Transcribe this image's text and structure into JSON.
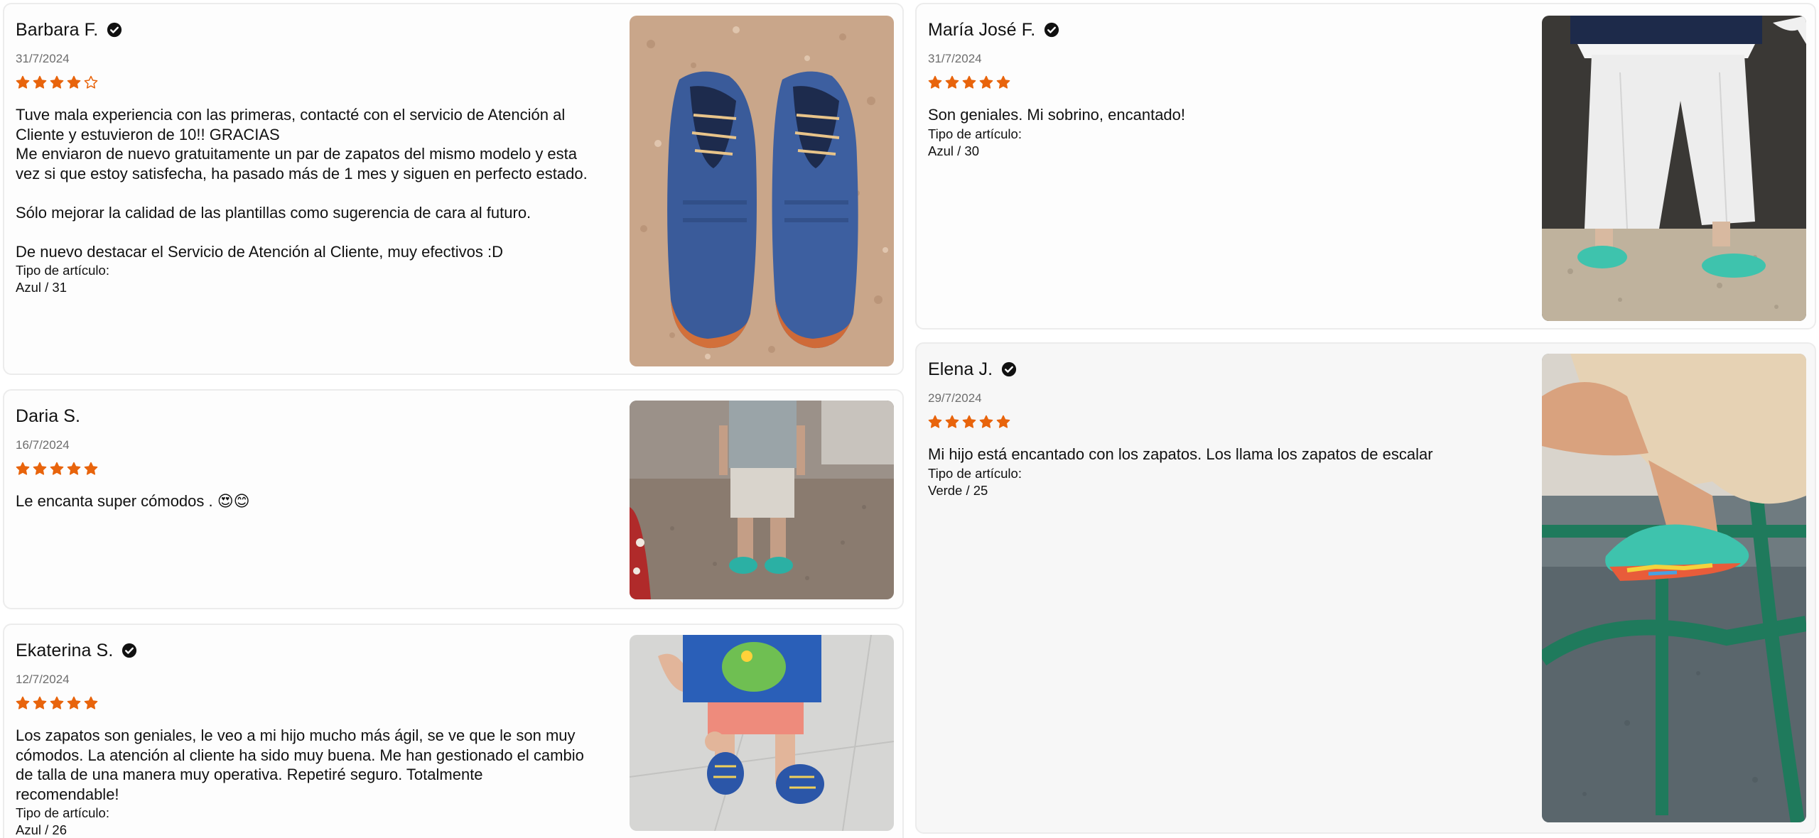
{
  "star_color": "#e8640c",
  "icons": {
    "verified": "check-badge-icon",
    "star_filled": "star-filled-icon",
    "star_empty": "star-outline-icon"
  },
  "reviews": [
    {
      "name": "Barbara F.",
      "verified": true,
      "date": "31/7/2024",
      "rating": 4,
      "text": "Tuve mala experiencia con las primeras, contacté con el servicio de Atención al\nCliente y estuvieron de 10!! GRACIAS\nMe enviaron de nuevo gratuitamente un par de zapatos del mismo modelo y esta\nvez si que estoy satisfecha, ha pasado más de 1 mes y siguen en perfecto estado.\n\nSólo mejorar la calidad de las plantillas como sugerencia de cara al futuro.\n\nDe nuevo destacar el Servicio de Atención al Cliente, muy efectivos :D",
      "article_label": "Tipo de artículo:",
      "article_value": "Azul / 31"
    },
    {
      "name": "Daria S.",
      "verified": false,
      "date": "16/7/2024",
      "rating": 5,
      "text": "Le encanta super cómodos . 😍😊",
      "article_label": "",
      "article_value": ""
    },
    {
      "name": "Ekaterina S.",
      "verified": true,
      "date": "12/7/2024",
      "rating": 5,
      "text": "Los zapatos son geniales, le veo a mi hijo mucho más ágil, se ve que le son muy\ncómodos. La atención al cliente ha sido muy buena. Me han gestionado el cambio\nde talla de una manera muy operativa. Repetiré seguro. Totalmente\nrecomendable!",
      "article_label": "Tipo de artículo:",
      "article_value": "Azul / 26"
    },
    {
      "name": "María José F.",
      "verified": true,
      "date": "31/7/2024",
      "rating": 5,
      "text": "Son geniales. Mi sobrino, encantado!",
      "article_label": "Tipo de artículo:",
      "article_value": "Azul / 30"
    },
    {
      "name": "Elena J.",
      "verified": true,
      "date": "29/7/2024",
      "rating": 5,
      "text": "Mi hijo está encantado con los zapatos. Los llama los zapatos de escalar",
      "article_label": "Tipo de artículo:",
      "article_value": "Verde / 25"
    }
  ]
}
